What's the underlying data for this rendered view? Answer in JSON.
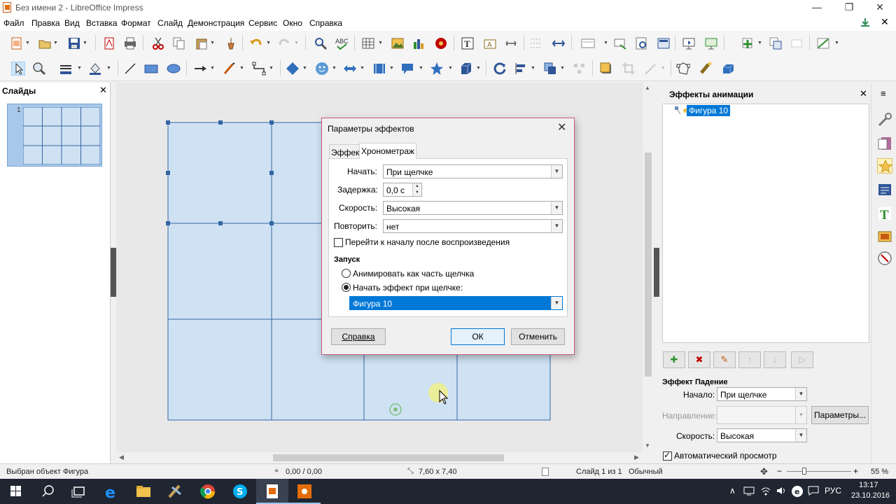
{
  "window": {
    "title": "Без имени 2 - LibreOffice Impress",
    "controls": [
      "—",
      "❐",
      "✕"
    ]
  },
  "menu": [
    "Файл",
    "Правка",
    "Вид",
    "Вставка",
    "Формат",
    "Слайд",
    "Демонстрация",
    "Сервис",
    "Окно",
    "Справка"
  ],
  "slides_pane": {
    "title": "Слайды",
    "close": "✕",
    "slide_number": "1"
  },
  "dialog": {
    "title": "Параметры эффектов",
    "close": "✕",
    "tabs": [
      "Эффект",
      "Хронометраж"
    ],
    "active_tab": "Хронометраж",
    "start_label": "Начать:",
    "start_value": "При щелчке",
    "delay_label": "Задержка:",
    "delay_value": "0,0 с",
    "speed_label": "Скорость:",
    "speed_value": "Высокая",
    "repeat_label": "Повторить:",
    "repeat_value": "нет",
    "rewind_label": "Перейти к началу после воспроизведения",
    "rewind_checked": false,
    "trigger_section": "Запуск",
    "radio_animate": "Анимировать как часть щелчка",
    "radio_start_on_click": "Начать эффект при щелчке:",
    "selected_radio": "radio_start_on_click",
    "trigger_object": "Фигура 10",
    "help_button": "Справка",
    "ok_button": "ОК",
    "cancel_button": "Отменить"
  },
  "sidebar": {
    "title": "Эффекты анимации",
    "close": "✕",
    "menu": "≡",
    "list_item": "Фигура 10",
    "effect_title": "Эффект Падение",
    "start_label": "Начало:",
    "start_value": "При щелчке",
    "direction_label": "Направление:",
    "direction_value": "",
    "params_button": "Параметры...",
    "speed_label": "Скорость:",
    "speed_value": "Высокая",
    "auto_preview_label": "Автоматический просмотр",
    "auto_preview_checked": true
  },
  "status": {
    "selection": "Выбран объект Фигура",
    "position": "0,00 / 0,00",
    "size": "7,60 x 7,40",
    "slide": "Слайд 1 из 1",
    "layout": "Обычный",
    "zoom": "55 %"
  },
  "taskbar": {
    "lang": "РУС",
    "time": "13:17",
    "date": "23.10.2016"
  },
  "colors": {
    "accent": "#0078d7",
    "shape_fill": "#cfe2f3",
    "shape_stroke": "#3465a4",
    "taskbar": "#1f2631",
    "dialog_border": "#c95e7a"
  }
}
